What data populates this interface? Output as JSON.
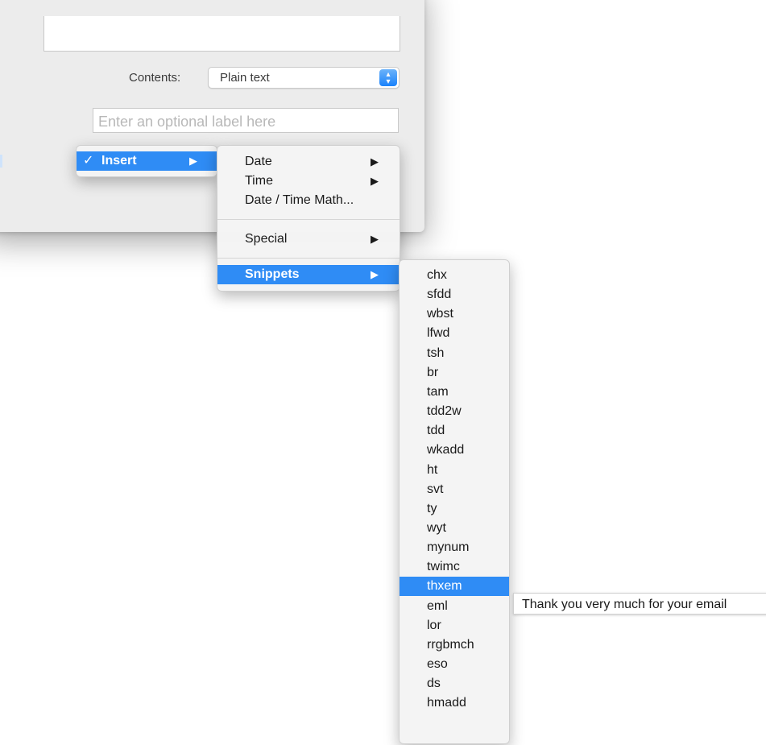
{
  "dialog": {
    "contents_label": "Contents:",
    "contents_value": "Plain text",
    "label_placeholder": "Enter an optional label here"
  },
  "insert_menu": {
    "check": "✓",
    "label": "Insert"
  },
  "insert_submenu": {
    "date": "Date",
    "time": "Time",
    "date_time_math": "Date / Time Math...",
    "special": "Special",
    "snippets": "Snippets"
  },
  "arrow": "▶",
  "snippets": [
    "chx",
    "sfdd",
    "wbst",
    "lfwd",
    "tsh",
    "br",
    "tam",
    "tdd2w",
    "tdd",
    "wkadd",
    "ht",
    "svt",
    "ty",
    "wyt",
    "mynum",
    "twimc",
    "thxem",
    "eml",
    "lor",
    "rrgbmch",
    "eso",
    "ds",
    "hmadd"
  ],
  "selected_snippet": "thxem",
  "tooltip": "Thank you very much for your email",
  "colors": {
    "selection": "#2f8cf5",
    "menu_bg": "#f4f4f4"
  }
}
